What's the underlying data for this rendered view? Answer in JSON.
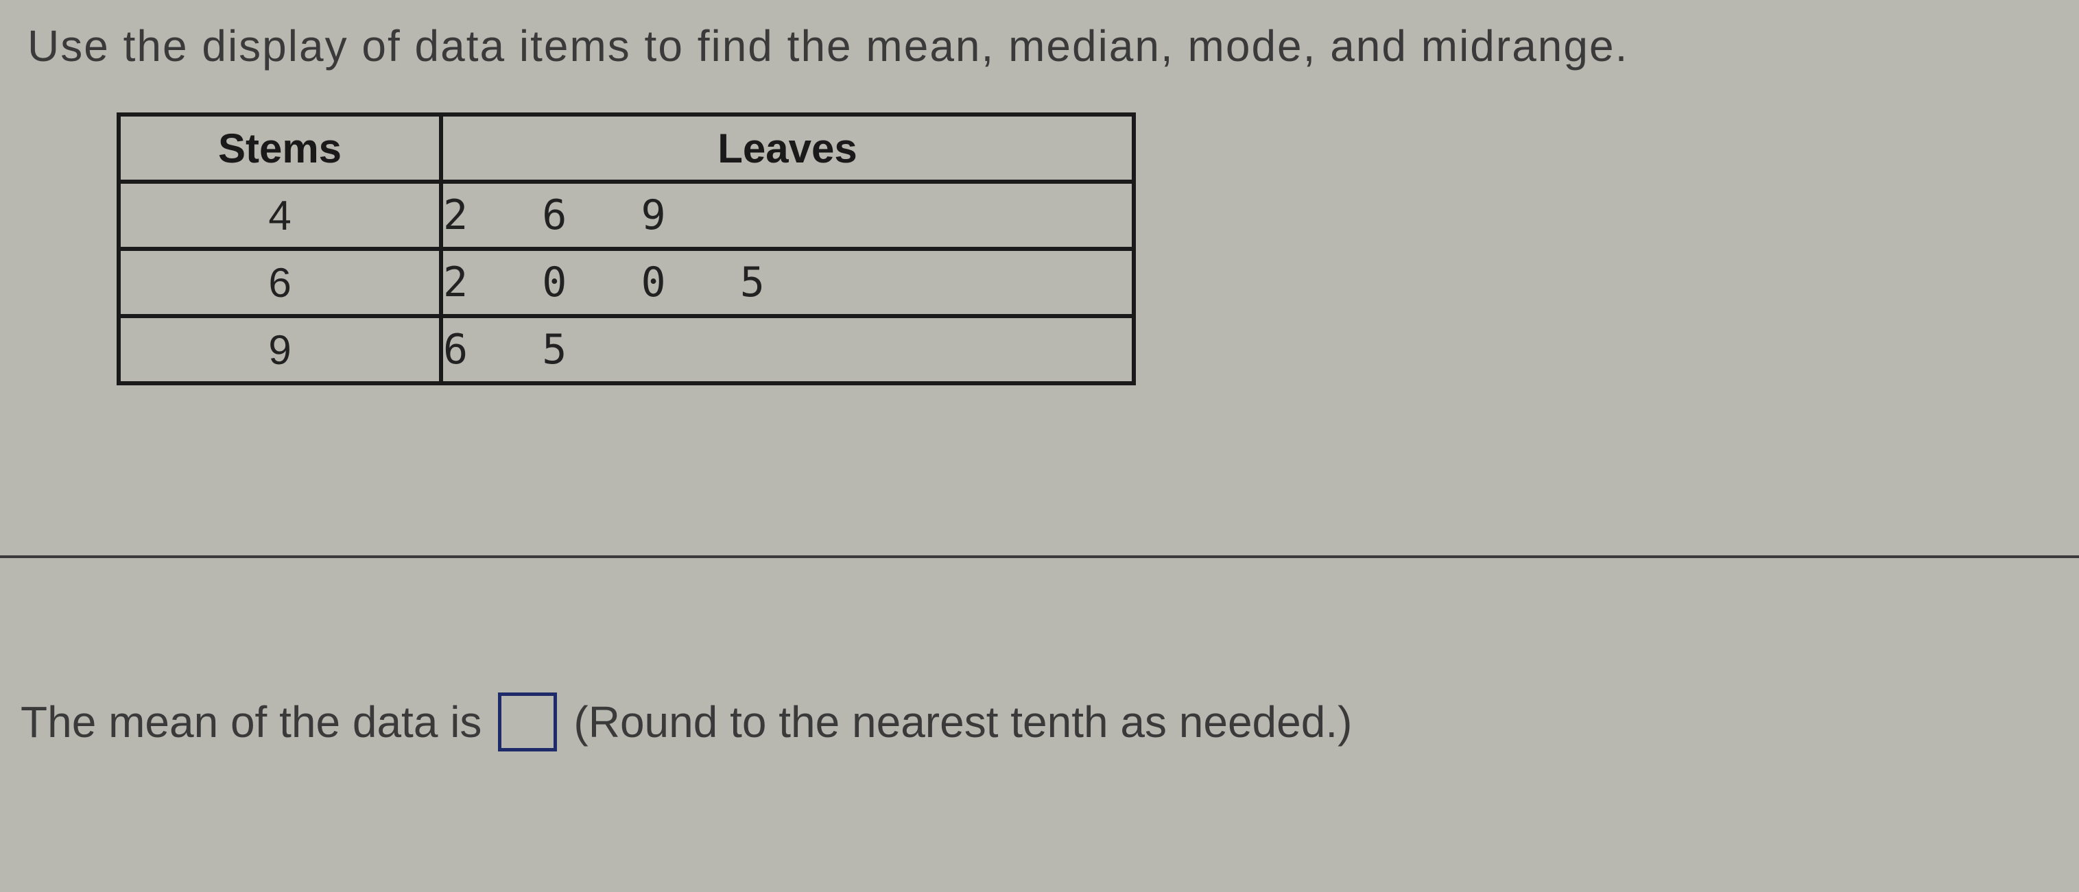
{
  "instruction": "Use the display of data items to find the mean, median, mode, and midrange.",
  "table": {
    "headers": {
      "stems": "Stems",
      "leaves": "Leaves"
    },
    "rows": [
      {
        "stem": "4",
        "leaves": "2 6 9"
      },
      {
        "stem": "6",
        "leaves": "2 0 0 5"
      },
      {
        "stem": "9",
        "leaves": "6 5"
      }
    ]
  },
  "answer": {
    "prefix": "The mean of the data is",
    "hint": "(Round to the nearest tenth as needed.)",
    "value": ""
  },
  "chart_data": {
    "type": "table",
    "description": "Stem-and-leaf plot",
    "stems": [
      4,
      6,
      9
    ],
    "leaves": [
      [
        2,
        6,
        9
      ],
      [
        2,
        0,
        0,
        5
      ],
      [
        6,
        5
      ]
    ],
    "values": [
      42,
      46,
      49,
      62,
      60,
      60,
      65,
      96,
      95
    ]
  }
}
